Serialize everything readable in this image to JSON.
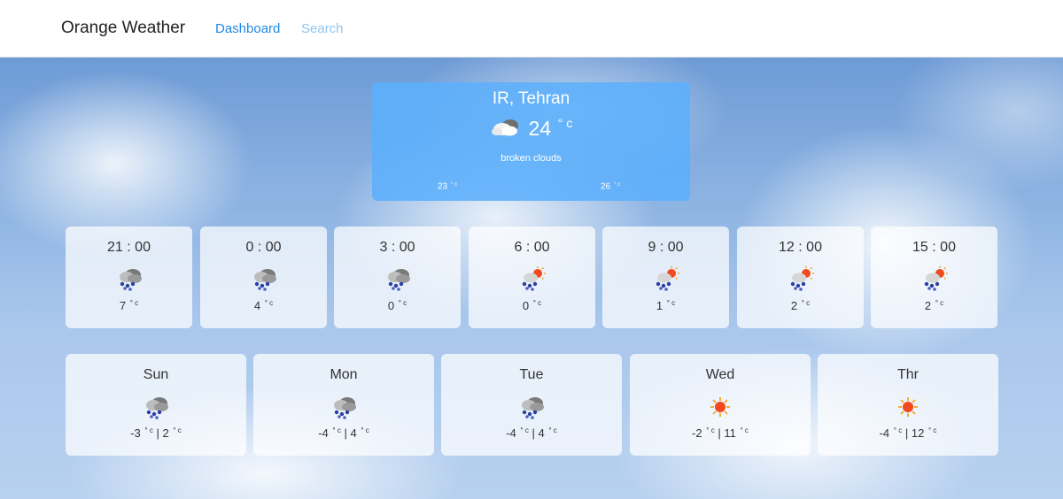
{
  "navbar": {
    "brand": "Orange Weather",
    "links": [
      {
        "label": "Dashboard",
        "active": true
      },
      {
        "label": "Search",
        "active": false
      }
    ]
  },
  "colors": {
    "accent": "#1e88e5",
    "current_card": "#5cafff"
  },
  "current": {
    "city": "IR, Tehran",
    "icon": "broken-clouds-icon",
    "temp": "24",
    "unit": "° c",
    "description": "broken clouds",
    "min_temp": "23",
    "max_temp": "26"
  },
  "hourly": [
    {
      "time": "21 : 00",
      "temp": "7",
      "icon": "snow-cloud-icon"
    },
    {
      "time": "0 : 00",
      "temp": "4",
      "icon": "snow-cloud-icon"
    },
    {
      "time": "3 : 00",
      "temp": "0",
      "icon": "snow-cloud-icon"
    },
    {
      "time": "6 : 00",
      "temp": "0",
      "icon": "snow-sun-icon"
    },
    {
      "time": "9 : 00",
      "temp": "1",
      "icon": "snow-sun-icon"
    },
    {
      "time": "12 : 00",
      "temp": "2",
      "icon": "snow-sun-icon"
    },
    {
      "time": "15 : 00",
      "temp": "2",
      "icon": "snow-sun-icon"
    }
  ],
  "daily": [
    {
      "day": "Sun",
      "min": "-3",
      "max": "2",
      "icon": "snow-cloud-icon"
    },
    {
      "day": "Mon",
      "min": "-4",
      "max": "4",
      "icon": "snow-cloud-icon"
    },
    {
      "day": "Tue",
      "min": "-4",
      "max": "4",
      "icon": "snow-cloud-icon"
    },
    {
      "day": "Wed",
      "min": "-2",
      "max": "11",
      "icon": "sun-icon"
    },
    {
      "day": "Thr",
      "min": "-4",
      "max": "12",
      "icon": "sun-icon"
    }
  ]
}
